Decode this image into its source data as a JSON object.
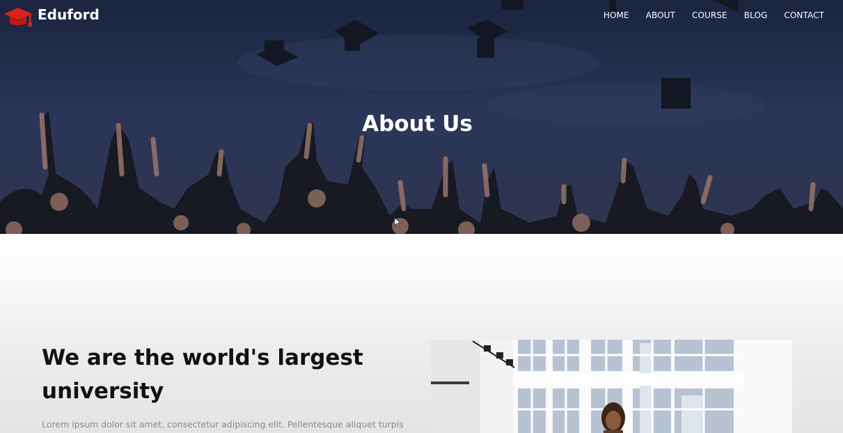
{
  "brand": {
    "name": "Eduford",
    "accent_color": "#e0201b",
    "icon": "graduation-cap-icon"
  },
  "nav": {
    "items": [
      "HOME",
      "ABOUT",
      "COURSE",
      "BLOG",
      "CONTACT"
    ]
  },
  "hero": {
    "title": "About Us"
  },
  "about": {
    "headline_line1": "We are the world's largest",
    "headline_line2": "university",
    "paragraph": "Lorem ipsum dolor sit amet, consectetur adipiscing elit. Pellentesque aliquet turpis"
  }
}
